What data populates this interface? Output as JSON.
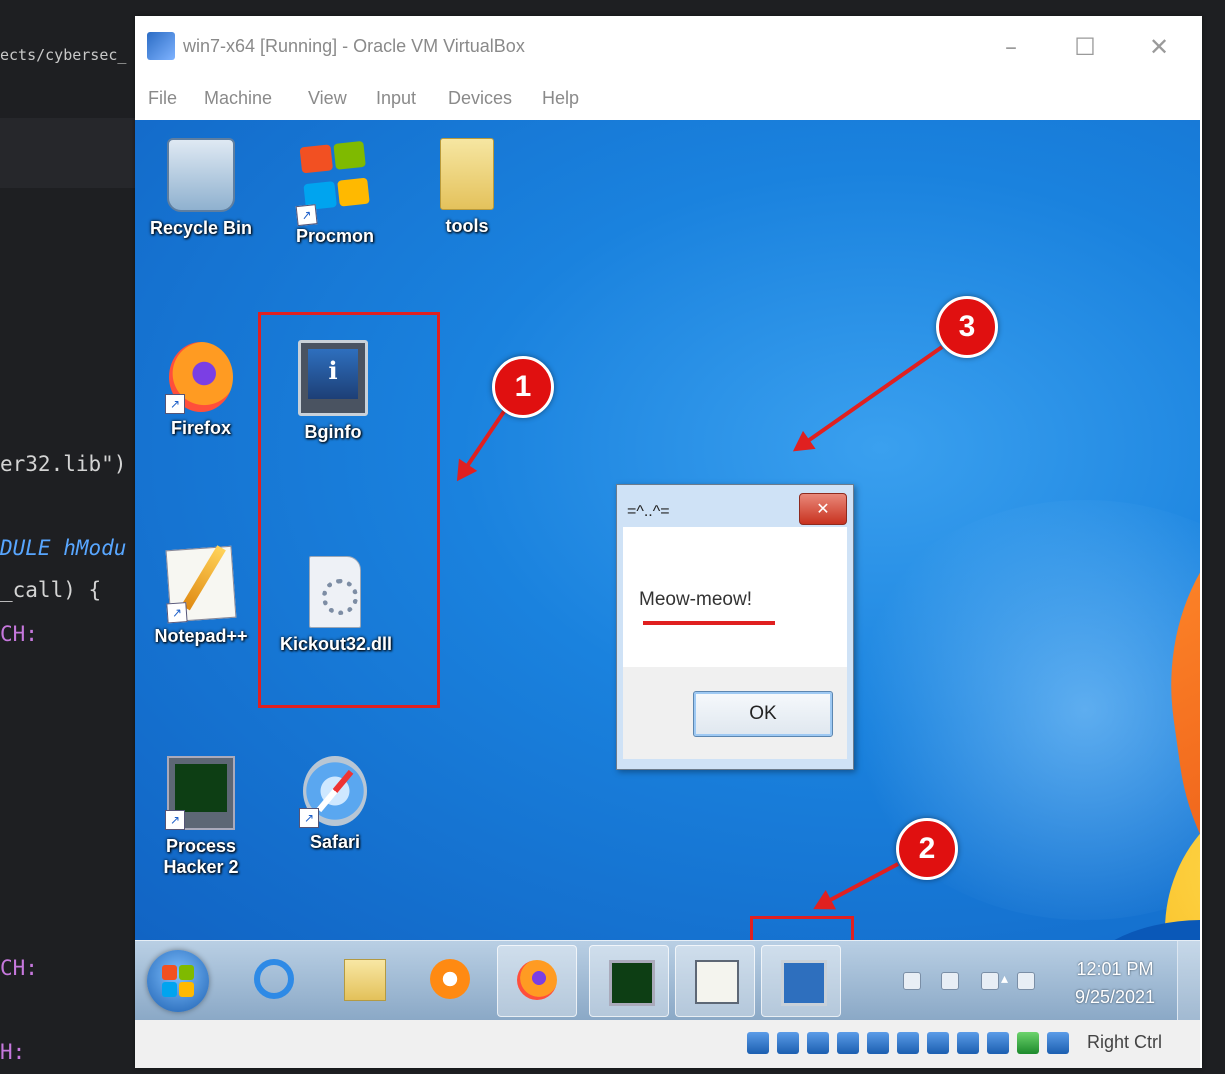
{
  "editor": {
    "path_fragment": "ects/cybersec_",
    "code_lines": [
      "er32.lib\")",
      "DULE hModu",
      "_call)  {",
      "CH:",
      "CH:",
      "H:"
    ]
  },
  "vm_window": {
    "title": "win7-x64 [Running] - Oracle VM VirtualBox",
    "controls": {
      "minimize": "–",
      "maximize": "☐",
      "close": "✕"
    },
    "menu": [
      "File",
      "Machine",
      "View",
      "Input",
      "Devices",
      "Help"
    ]
  },
  "desktop_icons": [
    {
      "label": "Recycle Bin",
      "icon": "recycle-bin-icon"
    },
    {
      "label": "Procmon",
      "icon": "procmon-icon"
    },
    {
      "label": "tools",
      "icon": "folder-icon"
    },
    {
      "label": "Firefox",
      "icon": "firefox-icon"
    },
    {
      "label": "Bginfo",
      "icon": "bginfo-icon"
    },
    {
      "label": "Notepad++",
      "icon": "notepad-plus-plus-icon"
    },
    {
      "label": "Kickout32.dll",
      "icon": "dll-file-icon"
    },
    {
      "label": "Process Hacker 2",
      "icon": "process-hacker-icon"
    },
    {
      "label": "Safari",
      "icon": "safari-icon"
    }
  ],
  "callouts": [
    "1",
    "2",
    "3"
  ],
  "message_box": {
    "caption": "=^..^=",
    "close_label": "✕",
    "text": "Meow-meow!",
    "ok_label": "OK"
  },
  "taskbar": {
    "buttons": [
      "start-button",
      "internet-explorer-icon",
      "explorer-icon",
      "media-player-icon",
      "firefox-icon",
      "process-hacker-icon",
      "procmon-icon",
      "bginfo-icon"
    ],
    "clock_time": "12:01 PM",
    "clock_date": "9/25/2021"
  },
  "statusbar": {
    "host_key": "Right Ctrl"
  },
  "colors": {
    "callout_red": "#e01010",
    "desktop_blue": "#1a82de",
    "taskbar": "#9fbad6"
  }
}
